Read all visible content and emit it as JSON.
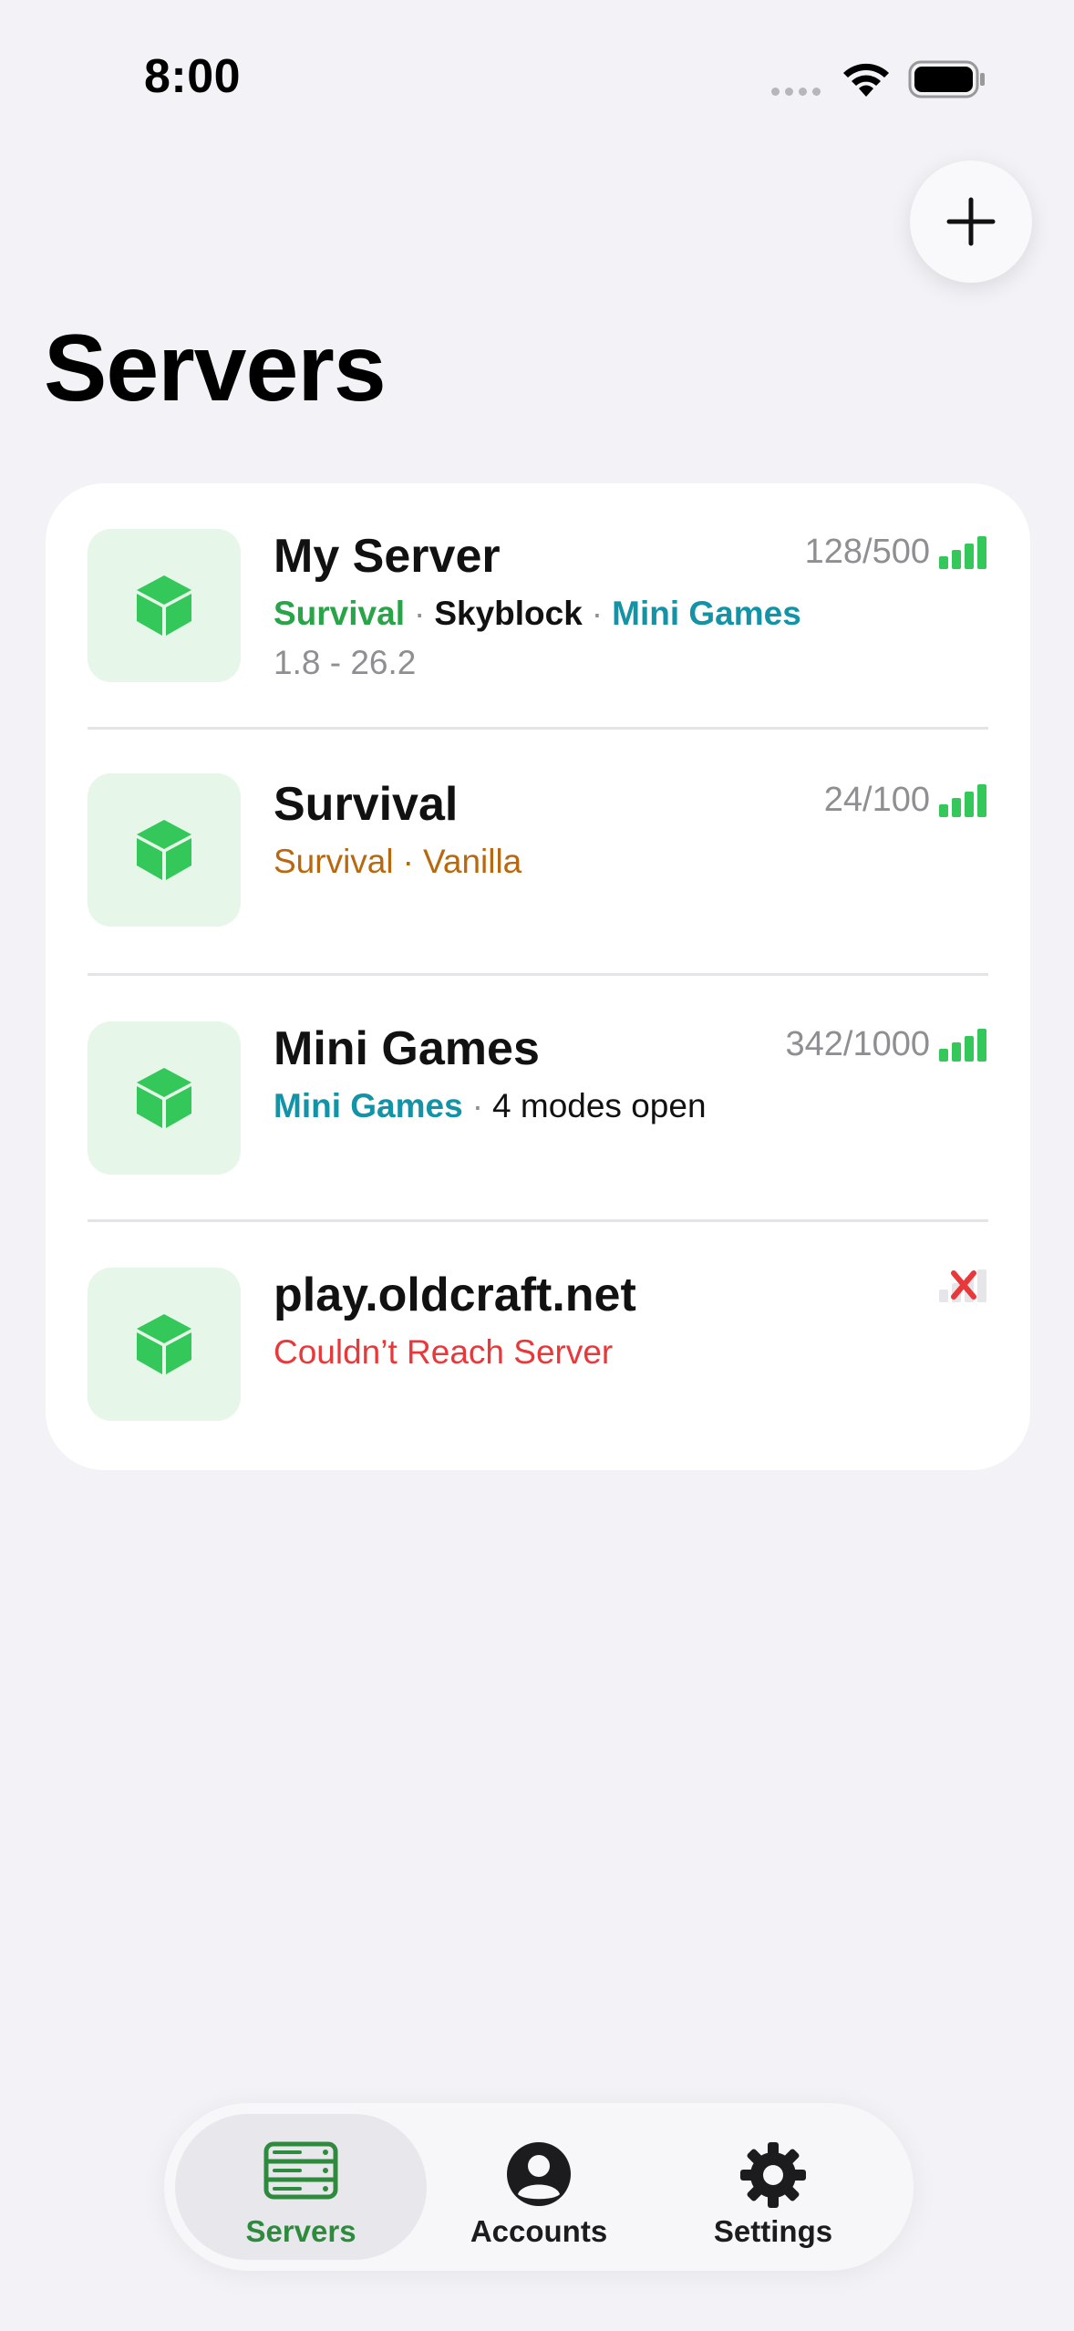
{
  "status_bar": {
    "time": "8:00"
  },
  "header": {
    "title": "Servers"
  },
  "colors": {
    "accent_green": "#34c759",
    "tab_active": "#2e8b3e",
    "error_red": "#e8383a"
  },
  "servers": [
    {
      "name": "My Server",
      "players": "128/500",
      "tags": [
        {
          "text": "Survival",
          "style": "green"
        },
        {
          "text": "Skyblock",
          "style": "black"
        },
        {
          "text": "Mini Games",
          "style": "teal"
        }
      ],
      "version": "1.8 - 26.2",
      "status": "online",
      "icon": "cube-icon"
    },
    {
      "name": "Survival",
      "players": "24/100",
      "tags_line": [
        "Survival",
        "Vanilla"
      ],
      "status": "online",
      "icon": "cube-icon"
    },
    {
      "name": "Mini Games",
      "players": "342/1000",
      "tag_primary": "Mini Games",
      "tag_secondary": "4 modes open",
      "status": "online",
      "icon": "cube-icon"
    },
    {
      "name": "play.oldcraft.net",
      "error": "Couldn’t Reach Server",
      "status": "unreachable",
      "icon": "cube-icon"
    }
  ],
  "tabs": [
    {
      "label": "Servers",
      "icon": "server-rack-icon",
      "active": true
    },
    {
      "label": "Accounts",
      "icon": "person-circle-icon",
      "active": false
    },
    {
      "label": "Settings",
      "icon": "gear-icon",
      "active": false
    }
  ]
}
